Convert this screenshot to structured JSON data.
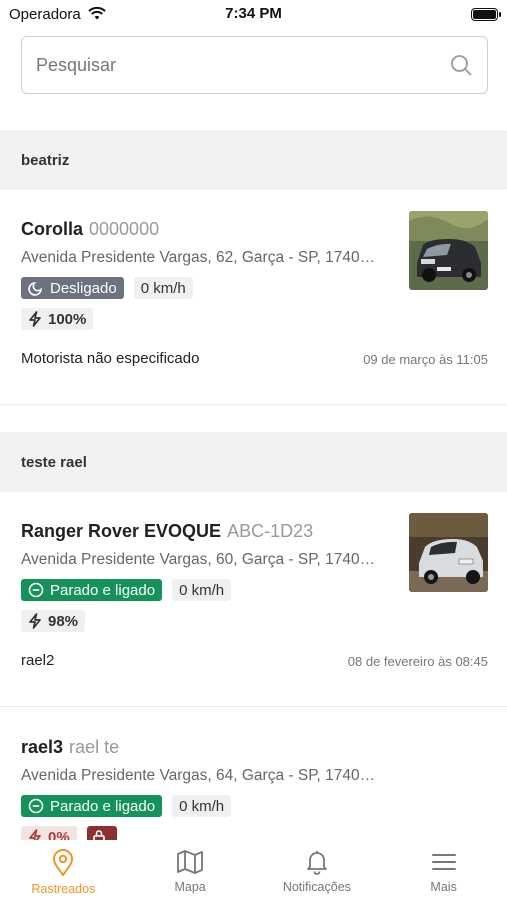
{
  "status_bar": {
    "carrier": "Operadora",
    "time": "7:34 PM"
  },
  "search": {
    "placeholder": "Pesquisar"
  },
  "groups": [
    {
      "name": "beatriz"
    },
    {
      "name": "teste rael"
    }
  ],
  "vehicles": [
    {
      "name": "Corolla",
      "plate": "0000000",
      "address": "Avenida Presidente Vargas, 62, Garça - SP, 17400...",
      "status": "Desligado",
      "speed": "0 km/h",
      "battery": "100%",
      "driver": "Motorista não especificado",
      "date": "09 de março às 11:05"
    },
    {
      "name": "Ranger Rover EVOQUE",
      "plate": "ABC-1D23",
      "address": "Avenida Presidente Vargas, 60, Garça - SP, 17400...",
      "status": "Parado e ligado",
      "speed": "0 km/h",
      "battery": "98%",
      "driver": "rael2",
      "date": "08 de fevereiro às 08:45"
    },
    {
      "name": "rael3",
      "plate": "rael te",
      "address": "Avenida Presidente Vargas, 64, Garça - SP, 17400...",
      "status": "Parado e ligado",
      "speed": "0 km/h",
      "battery": "0%"
    }
  ],
  "tabbar": {
    "tabs": [
      {
        "label": "Rastreados",
        "icon": "map-pin-icon",
        "active": true
      },
      {
        "label": "Mapa",
        "icon": "map-icon",
        "active": false
      },
      {
        "label": "Notificações",
        "icon": "bell-icon",
        "active": false
      },
      {
        "label": "Mais",
        "icon": "menu-icon",
        "active": false
      }
    ]
  },
  "colors": {
    "accent": "#f29422",
    "status_off": "#6b7280",
    "status_idle": "#14925a",
    "lock": "#8b3030"
  }
}
